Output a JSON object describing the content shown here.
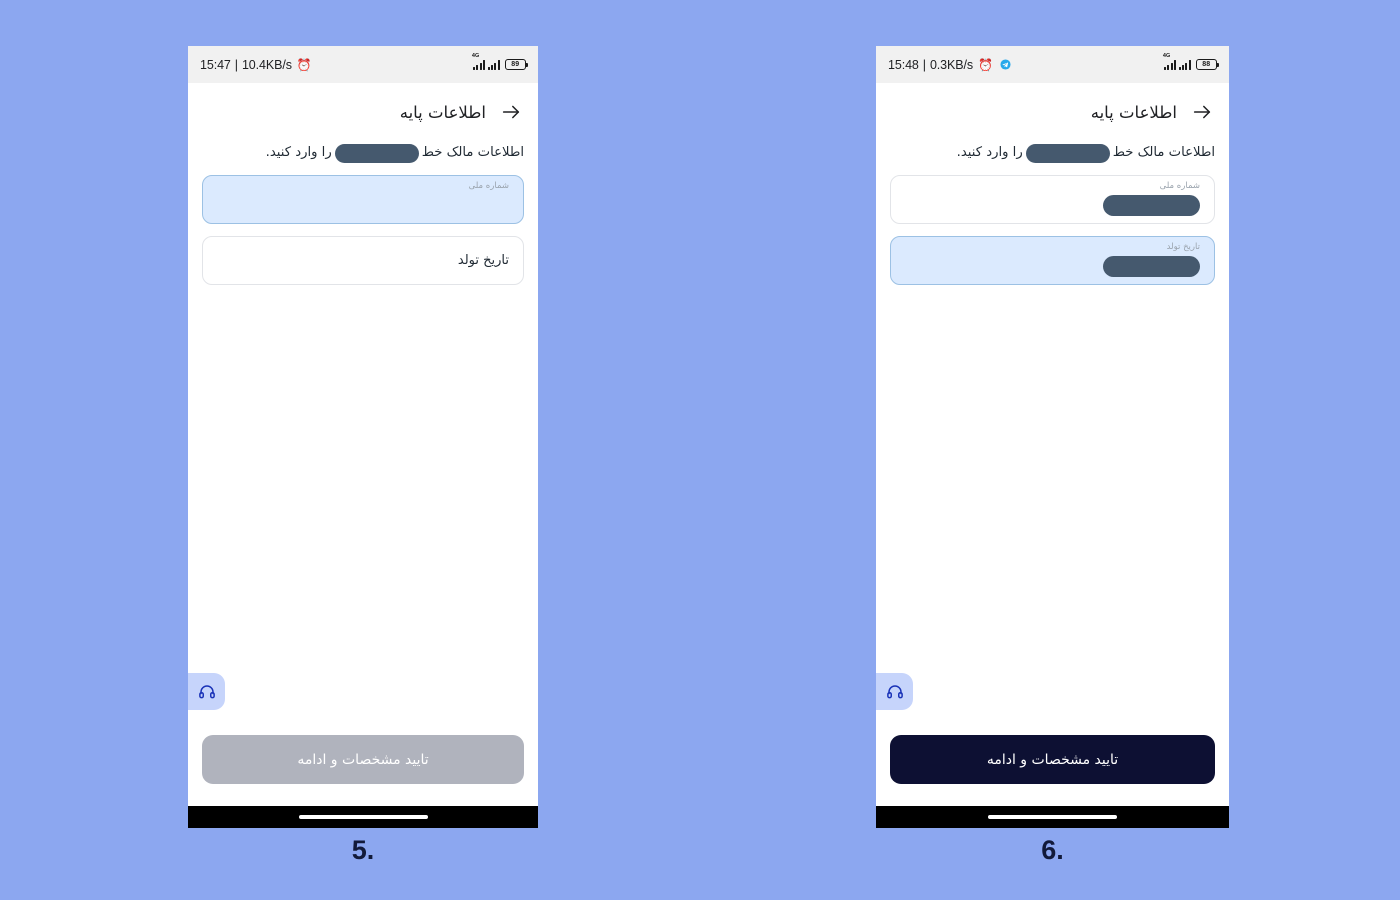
{
  "page": {
    "background_color": "#8ca7f0"
  },
  "phones": [
    {
      "id": "phone-5",
      "step_caption": "5.",
      "status_bar": {
        "time": "15:47",
        "separator": "|",
        "network_speed": "10.4KB/s",
        "alarm_icon": "alarm-clock-icon",
        "has_telegram_icon": false,
        "network_type": "4G",
        "battery_level": "89"
      },
      "appbar": {
        "back_icon": "back-arrow-icon",
        "title": "اطلاعات پایه"
      },
      "subtitle": {
        "before": "اطلاعات مالک خط",
        "redacted": "",
        "after": "را وارد کنید."
      },
      "fields": [
        {
          "name": "national-id-field",
          "float_label": "شماره ملی",
          "center_label": "",
          "value_redacted": false,
          "state": "active"
        },
        {
          "name": "birth-date-field",
          "float_label": "",
          "center_label": "تاریخ تولد",
          "value_redacted": false,
          "state": "idle"
        }
      ],
      "support_button": {
        "icon": "headset-icon"
      },
      "cta": {
        "label": "تایید مشخصات و ادامه",
        "state": "disabled"
      }
    },
    {
      "id": "phone-6",
      "step_caption": "6.",
      "status_bar": {
        "time": "15:48",
        "separator": "|",
        "network_speed": "0.3KB/s",
        "alarm_icon": "alarm-clock-icon",
        "has_telegram_icon": true,
        "telegram_icon": "telegram-icon",
        "network_type": "4G",
        "battery_level": "88"
      },
      "appbar": {
        "back_icon": "back-arrow-icon",
        "title": "اطلاعات پایه"
      },
      "subtitle": {
        "before": "اطلاعات مالک خط",
        "redacted": "",
        "after": "را وارد کنید."
      },
      "fields": [
        {
          "name": "national-id-field",
          "float_label": "شماره ملی",
          "center_label": "",
          "value_redacted": true,
          "state": "idle"
        },
        {
          "name": "birth-date-field",
          "float_label": "تاریخ تولد",
          "center_label": "",
          "value_redacted": true,
          "state": "active"
        }
      ],
      "support_button": {
        "icon": "headset-icon"
      },
      "cta": {
        "label": "تایید مشخصات و ادامه",
        "state": "enabled"
      }
    }
  ],
  "colors": {
    "page_background": "#8ca7f0",
    "active_field_fill": "#dbeafe",
    "active_field_border": "#9cc1e4",
    "redaction_pill": "#45596e",
    "cta_enabled": "#0d1033",
    "cta_disabled": "#b0b3bd",
    "support_chip": "#c6d4fb",
    "support_icon": "#1a33b8",
    "status_bar_bg": "#f1f1f1",
    "nav_bar_bg": "#000000"
  }
}
